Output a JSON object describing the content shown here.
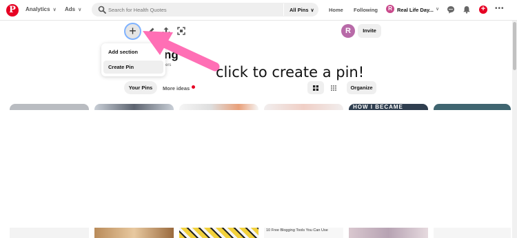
{
  "topbar": {
    "logo_letter": "P",
    "nav": [
      {
        "label": "Analytics"
      },
      {
        "label": "Ads"
      }
    ],
    "search": {
      "placeholder": "Search for Health Quotes",
      "scope": "All Pins"
    },
    "links": [
      {
        "label": "Home"
      },
      {
        "label": "Following"
      }
    ],
    "profile": {
      "name": "Real Life Day...",
      "avatar_letter": "R"
    },
    "icons": [
      "search-icon",
      "chevron-down-icon",
      "chat-icon",
      "bell-icon",
      "plus-icon",
      "more-icon"
    ]
  },
  "board": {
    "title_fragment": "ng",
    "subtitle_fragment": "ers",
    "invite_avatar_letter": "R",
    "invite_label": "Invite",
    "add_symbol": "+"
  },
  "dropdown": {
    "items": [
      {
        "label": "Add section"
      },
      {
        "label": "Create Pin"
      }
    ]
  },
  "annotation": {
    "text": "click to create a pin!",
    "arrow_color": "#ff6fb5"
  },
  "tabs": {
    "your_pins": "Your Pins",
    "more_ideas": "More ideas",
    "organize": "Organize"
  },
  "pins": {
    "top_texts": [
      "",
      "",
      "",
      "",
      "HOW I BECAME",
      ""
    ],
    "bottom_texts": [
      "",
      "",
      "",
      "10 Free Blogging Tools You Can Use",
      "",
      ""
    ]
  },
  "colors": {
    "brand_red": "#e60023",
    "accent_blue": "#7fb2ff",
    "pill_gray": "#efefef"
  }
}
